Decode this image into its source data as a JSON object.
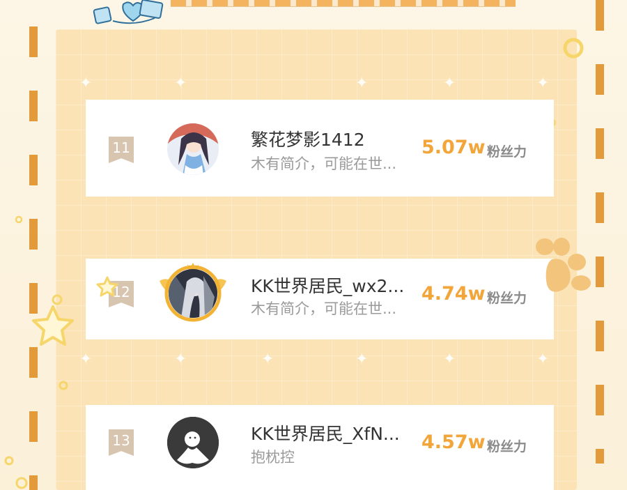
{
  "ranking": {
    "entries": [
      {
        "rank": "11",
        "name": "繁花梦影1412",
        "bio": "木有简介，可能在世...",
        "score": "5.07w",
        "unit": "粉丝力"
      },
      {
        "rank": "12",
        "name": "KK世界居民_wx2...",
        "bio": "木有简介，可能在世...",
        "score": "4.74w",
        "unit": "粉丝力"
      },
      {
        "rank": "13",
        "name": "KK世界居民_XfN...",
        "bio": "抱枕控",
        "score": "4.57w",
        "unit": "粉丝力"
      }
    ]
  },
  "colors": {
    "accent_orange": "#f2a63a",
    "dash_border": "#e39a3b",
    "panel_bg": "#fbe3b5",
    "rank_badge": "#d7c5b0"
  },
  "icons": [
    "dice-sticker-icon",
    "paw-print-icon",
    "star-outline-icon",
    "crown-frame-icon",
    "default-avatar-icon"
  ]
}
